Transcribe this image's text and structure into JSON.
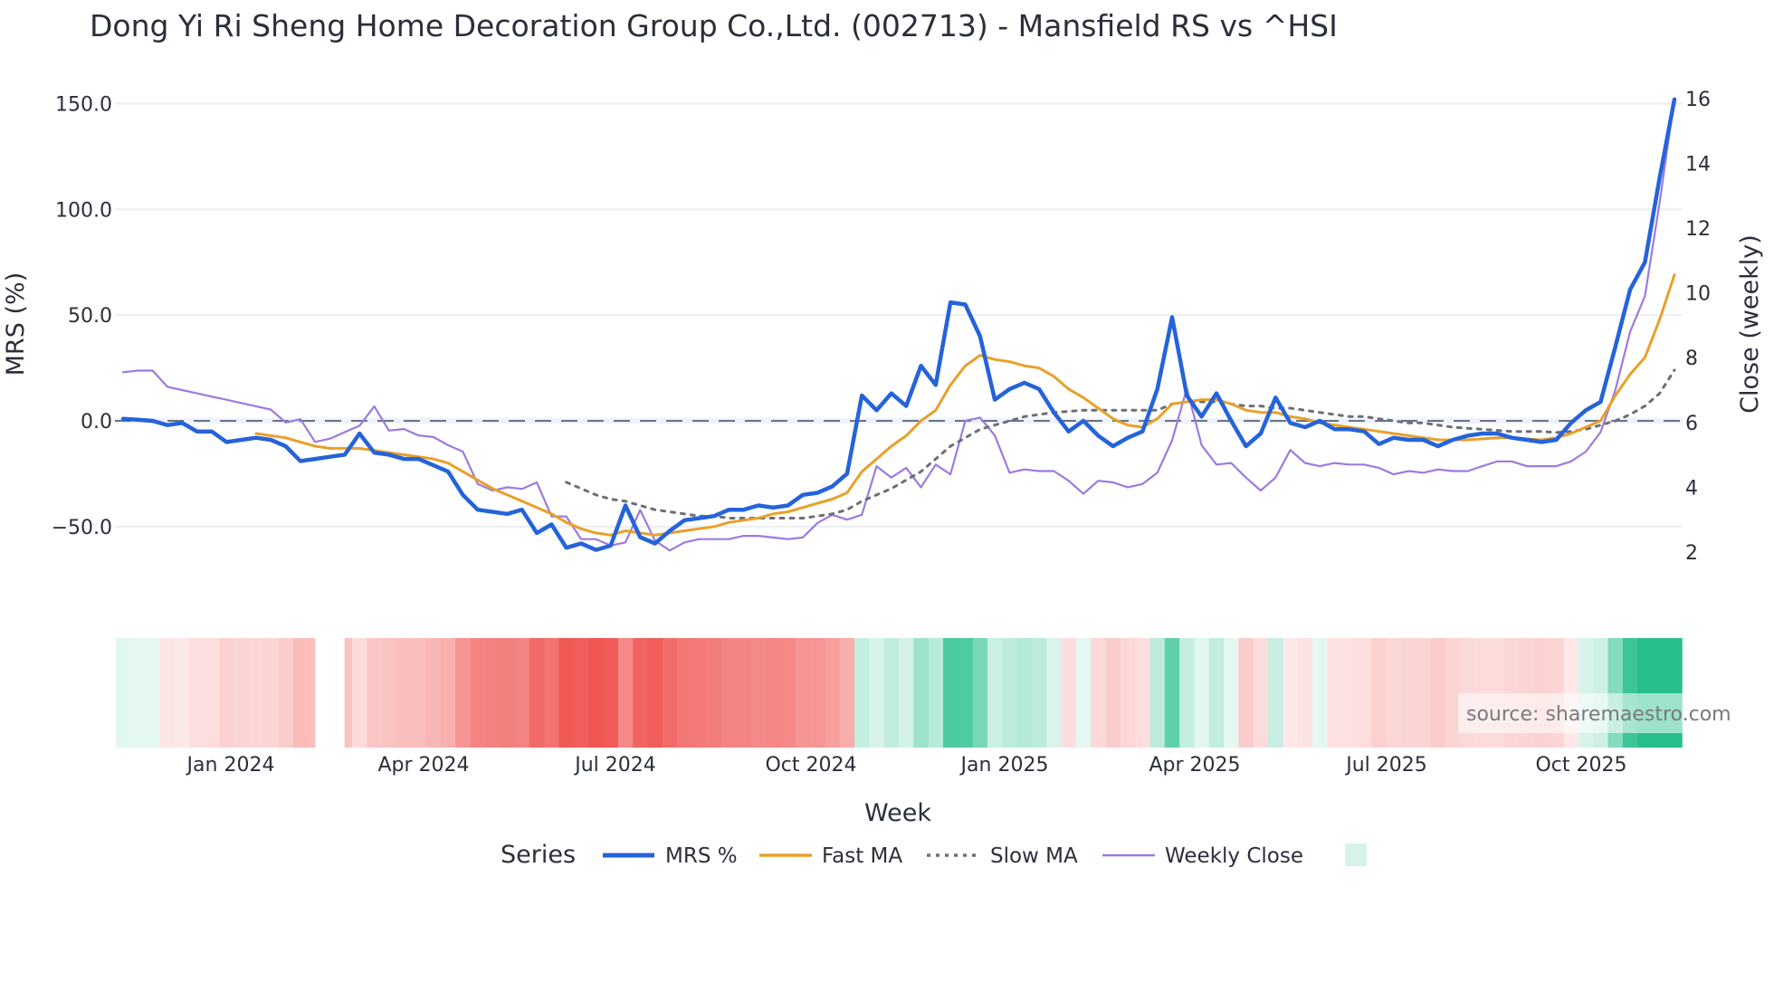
{
  "chart_data": {
    "type": "line",
    "title": "Dong Yi Ri Sheng Home Decoration Group Co.,Ltd. (002713) - Mansfield RS vs ^HSI",
    "xlabel": "Week",
    "ylabel": "MRS (%)",
    "y2label": "Close (weekly)",
    "ylim": [
      -75,
      160
    ],
    "y2lim": [
      1.2,
      16.2
    ],
    "yticks": [
      "150.0",
      "100.0",
      "50.0",
      "0.0",
      "−50.0"
    ],
    "ytick_values": [
      150,
      100,
      50,
      0,
      -50
    ],
    "y2ticks": [
      "16",
      "14",
      "12",
      "10",
      "8",
      "6",
      "4",
      "2"
    ],
    "y2tick_values": [
      16,
      14,
      12,
      10,
      8,
      6,
      4,
      2
    ],
    "xticks": [
      "Jan 2024",
      "Apr 2024",
      "Jul 2024",
      "Oct 2024",
      "Jan 2025",
      "Apr 2025",
      "Jul 2025",
      "Oct 2025"
    ],
    "x_unit": "week index (weekly, ~Nov 2023 to Nov 2025)",
    "zero_line": 0,
    "grid": true,
    "legend_title": "Series",
    "legend_placement": "bottom-center",
    "series": [
      {
        "name": "MRS %",
        "axis": "left",
        "color": "#2563d9",
        "values": [
          1,
          0.5,
          0,
          -2,
          -1,
          -5,
          -5,
          -10,
          -9,
          -8,
          -9,
          -12,
          -19,
          -18,
          -17,
          -16,
          -6,
          -15,
          -16,
          -18,
          -18,
          -21,
          -24,
          -35,
          -42,
          -43,
          -44,
          -42,
          -53,
          -49,
          -60,
          -58,
          -61,
          -59,
          -40,
          -55,
          -58,
          -52,
          -47,
          -46,
          -45,
          -42,
          -42,
          -40,
          -41,
          -40,
          -35,
          -34,
          -31,
          -25,
          12,
          5,
          13,
          7,
          26,
          17,
          56,
          55,
          40,
          10,
          15,
          18,
          15,
          4,
          -5,
          0,
          -7,
          -12,
          -8,
          -5,
          15,
          49,
          12,
          2,
          13,
          0,
          -12,
          -6,
          11,
          -1,
          -3,
          0,
          -4,
          -4,
          -5,
          -11,
          -8,
          -9,
          -9,
          -12,
          -9,
          -7,
          -6,
          -6,
          -8,
          -9,
          -10,
          -9,
          -1,
          5,
          9,
          35,
          62,
          75,
          115,
          152
        ]
      },
      {
        "name": "Fast MA",
        "axis": "left",
        "color": "#e8a02a",
        "values": [
          null,
          null,
          null,
          null,
          null,
          null,
          null,
          null,
          null,
          -6,
          -7,
          -8,
          -10,
          -12,
          -13,
          -13,
          -13,
          -14,
          -15,
          -16,
          -17,
          -18,
          -20,
          -24,
          -28,
          -32,
          -35,
          -38,
          -41,
          -44,
          -48,
          -51,
          -53,
          -54,
          -52,
          -53,
          -54,
          -53,
          -52,
          -51,
          -50,
          -48,
          -47,
          -46,
          -44,
          -43,
          -41,
          -39,
          -37,
          -34,
          -24,
          -18,
          -12,
          -7,
          0,
          5,
          17,
          26,
          31,
          29,
          28,
          26,
          25,
          21,
          15,
          11,
          6,
          1,
          -2,
          -3,
          1,
          8,
          9,
          10,
          10,
          8,
          5,
          4,
          4,
          2,
          1,
          -1,
          -2,
          -3,
          -4,
          -5,
          -6,
          -7,
          -8,
          -9,
          -9,
          -9,
          -8.5,
          -8,
          -8,
          -8.5,
          -9,
          -8,
          -6,
          -3,
          0,
          12,
          22,
          30,
          48,
          69
        ]
      },
      {
        "name": "Slow MA",
        "axis": "left",
        "color": "#6b6f76",
        "dash": "dotted",
        "values": [
          null,
          null,
          null,
          null,
          null,
          null,
          null,
          null,
          null,
          null,
          null,
          null,
          null,
          null,
          null,
          null,
          null,
          null,
          null,
          null,
          null,
          null,
          null,
          null,
          null,
          null,
          null,
          null,
          null,
          null,
          -29,
          -32,
          -35,
          -37,
          -38,
          -40,
          -42,
          -43,
          -44,
          -45,
          -45,
          -46,
          -46,
          -46,
          -46,
          -46,
          -46,
          -45,
          -44,
          -42,
          -38,
          -35,
          -32,
          -28,
          -24,
          -18,
          -12,
          -8,
          -4,
          -2,
          0,
          2,
          3,
          4,
          4.5,
          5,
          5,
          5,
          5,
          5,
          5,
          8,
          9,
          9,
          9,
          8,
          7,
          7,
          6,
          6,
          5,
          4,
          3,
          2,
          2,
          1,
          0,
          -1,
          -1,
          -2,
          -3,
          -3.5,
          -4,
          -4.5,
          -5,
          -5,
          -5,
          -5.5,
          -5,
          -4,
          -2,
          0,
          3,
          7,
          13,
          24
        ]
      },
      {
        "name": "Weekly Close",
        "axis": "right",
        "color": "#9b7be0",
        "values": [
          7.55,
          7.6,
          7.6,
          7.1,
          7.0,
          6.9,
          6.8,
          6.7,
          6.6,
          6.5,
          6.4,
          6.0,
          6.1,
          5.4,
          5.5,
          5.7,
          5.9,
          6.5,
          5.75,
          5.8,
          5.6,
          5.55,
          5.3,
          5.1,
          4.1,
          3.9,
          4.0,
          3.95,
          4.15,
          3.1,
          3.1,
          2.4,
          2.4,
          2.2,
          2.3,
          3.3,
          2.35,
          2.05,
          2.3,
          2.4,
          2.4,
          2.4,
          2.5,
          2.5,
          2.45,
          2.4,
          2.45,
          2.9,
          3.15,
          3.0,
          3.15,
          4.65,
          4.3,
          4.6,
          4.0,
          4.7,
          4.4,
          6.05,
          6.15,
          5.6,
          4.45,
          4.55,
          4.5,
          4.5,
          4.2,
          3.8,
          4.2,
          4.15,
          4.0,
          4.1,
          4.45,
          5.45,
          7.05,
          5.3,
          4.7,
          4.75,
          4.3,
          3.9,
          4.3,
          5.15,
          4.75,
          4.65,
          4.75,
          4.7,
          4.7,
          4.6,
          4.4,
          4.5,
          4.45,
          4.55,
          4.5,
          4.5,
          4.65,
          4.8,
          4.8,
          4.65,
          4.65,
          4.65,
          4.8,
          5.1,
          5.7,
          7.0,
          8.8,
          9.9,
          12.8,
          16.0
        ]
      }
    ],
    "heatmap": {
      "name": "MRS heat strip",
      "negative_color": "#ef5350",
      "positive_color": "#26bf8c",
      "missing_index": 14
    }
  },
  "source_label": "source: sharemaestro.com"
}
